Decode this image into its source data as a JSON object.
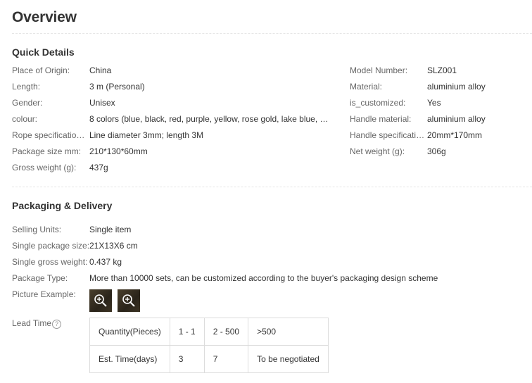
{
  "page": {
    "title": "Overview"
  },
  "quick_details": {
    "title": "Quick Details",
    "left": [
      {
        "label": "Place of Origin:",
        "value": "China"
      },
      {
        "label": "Length:",
        "value": "3 m (Personal)"
      },
      {
        "label": "Gender:",
        "value": "Unisex"
      },
      {
        "label": "colour:",
        "value": "8 colors (blue, black, red, purple, yellow, rose gold, lake blue, g..."
      },
      {
        "label": "Rope specification ...",
        "value": "Line diameter 3mm; length 3M"
      },
      {
        "label": "Package size mm:",
        "value": "210*130*60mm"
      },
      {
        "label": "Gross weight (g):",
        "value": "437g"
      }
    ],
    "right": [
      {
        "label": "Model Number:",
        "value": "SLZ001"
      },
      {
        "label": "Material:",
        "value": "aluminium alloy"
      },
      {
        "label": "is_customized:",
        "value": "Yes"
      },
      {
        "label": "Handle material:",
        "value": "aluminium alloy"
      },
      {
        "label": "Handle specificatio...",
        "value": "20mm*170mm"
      },
      {
        "label": "Net weight (g):",
        "value": "306g"
      }
    ]
  },
  "packaging": {
    "title": "Packaging & Delivery",
    "rows": [
      {
        "label": "Selling Units:",
        "value": "Single item"
      },
      {
        "label": "Single package size:",
        "value": "21X13X6 cm"
      },
      {
        "label": "Single gross weight:",
        "value": "0.437 kg"
      },
      {
        "label": "Package Type:",
        "value": "More than 10000 sets, can be customized according to the buyer's packaging design scheme"
      }
    ],
    "picture_label": "Picture Example:",
    "picture_icons": [
      "zoom-in-icon",
      "zoom-in-icon"
    ],
    "lead_time_label": "Lead Time",
    "lead_time_help": "?",
    "lead_table": {
      "row1": [
        "Quantity(Pieces)",
        "1 - 1",
        "2 - 500",
        ">500"
      ],
      "row2": [
        "Est. Time(days)",
        "3",
        "7",
        "To be negotiated"
      ]
    }
  }
}
